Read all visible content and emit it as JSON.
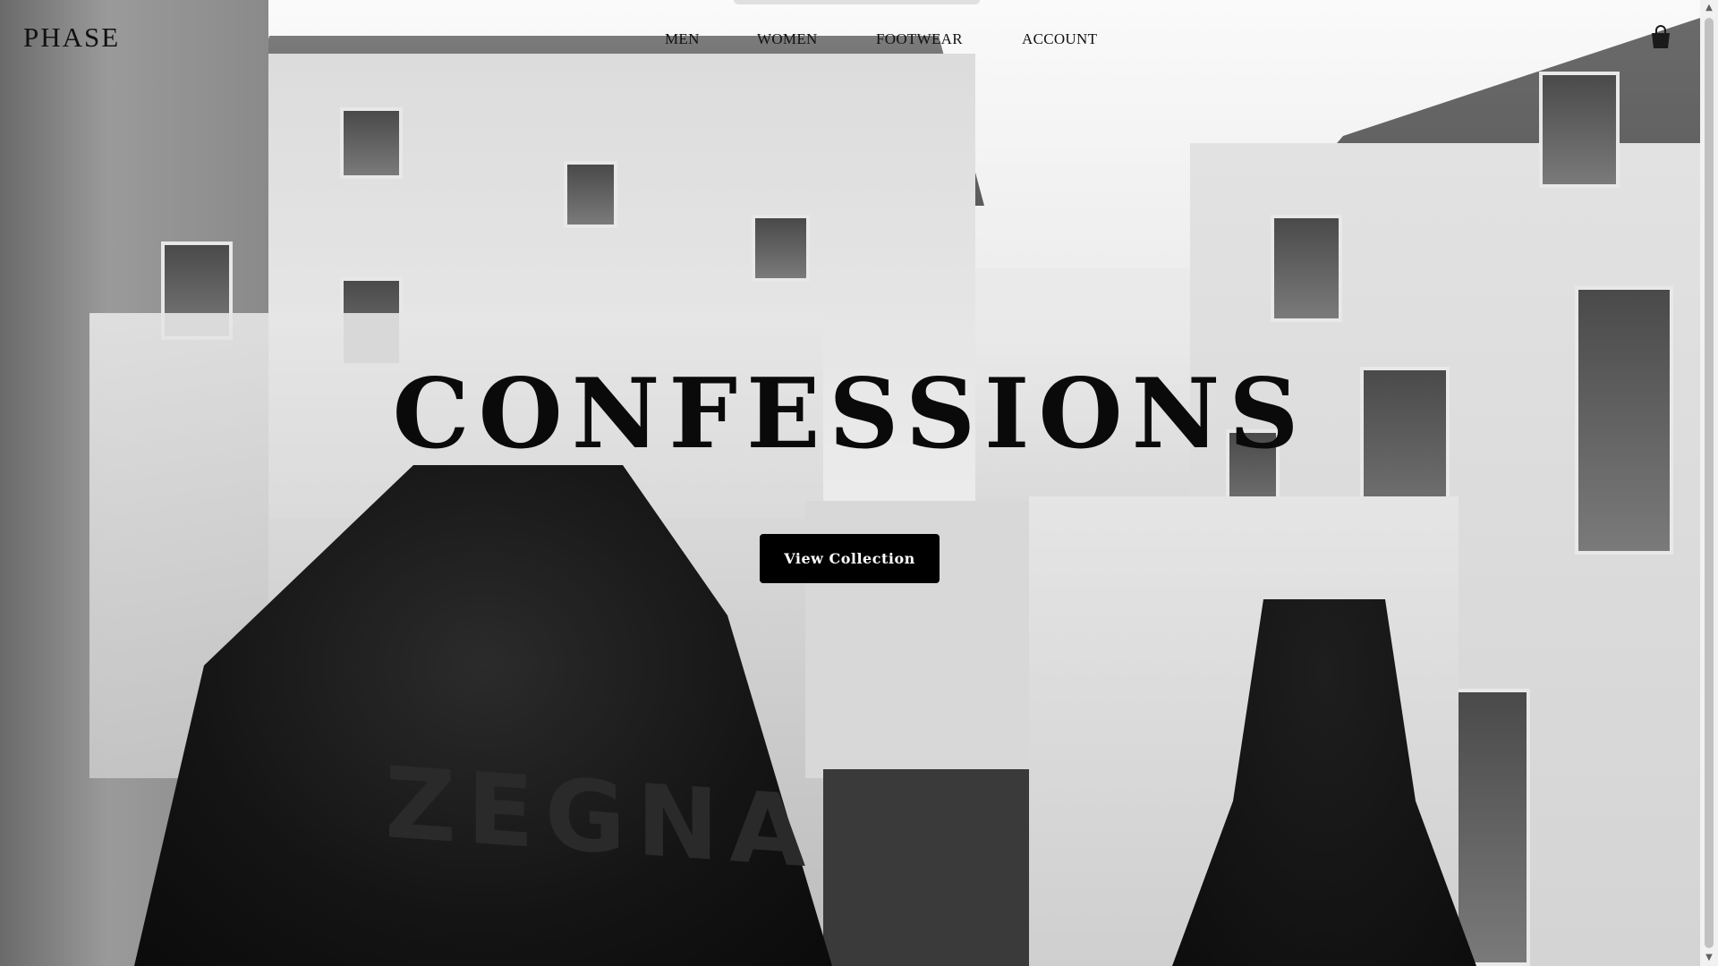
{
  "brand": {
    "name": "PHASE"
  },
  "nav": {
    "items": [
      {
        "label": "MEN"
      },
      {
        "label": "WOMEN"
      },
      {
        "label": "FOOTWEAR"
      },
      {
        "label": "ACCOUNT"
      }
    ]
  },
  "header": {
    "cart_icon": "shopping-bag-icon"
  },
  "hero": {
    "headline": "CONFESSIONS",
    "cta_label": "View Collection",
    "image_text": "ZEGNA"
  },
  "colors": {
    "cta_background": "#000000",
    "cta_text": "#ffffff",
    "text": "#111111"
  }
}
